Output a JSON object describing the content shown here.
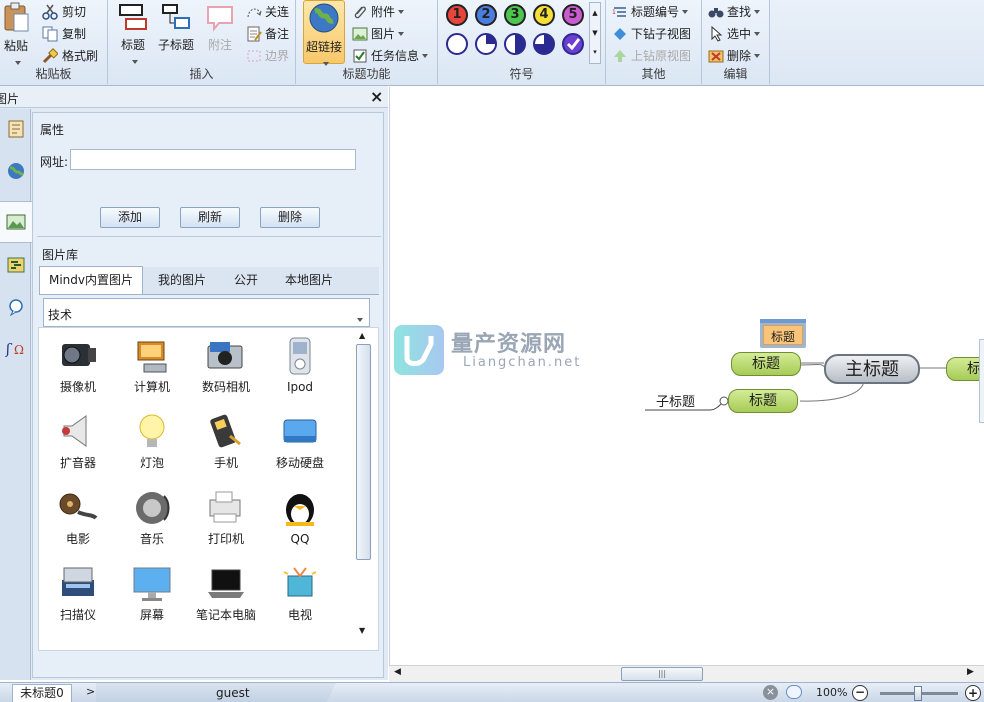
{
  "ribbon": {
    "clipboard": {
      "paste": "粘贴",
      "cut": "剪切",
      "copy": "复制",
      "format_painter": "格式刷",
      "group": "粘贴板"
    },
    "insert": {
      "topic": "标题",
      "subtopic": "子标题",
      "callout": "附注",
      "relation": "关连",
      "note": "备注",
      "boundary": "边界",
      "group": "插入"
    },
    "topic_func": {
      "hyperlink": "超链接",
      "attachment": "附件",
      "image": "图片",
      "task": "任务信息",
      "group": "标题功能"
    },
    "symbols": {
      "items": [
        "1",
        "2",
        "3",
        "4",
        "5"
      ],
      "group": "符号"
    },
    "other": {
      "numbering": "标题编号",
      "drill_down": "下钻子视图",
      "drill_up": "上钻原视图",
      "group": "其他"
    },
    "edit": {
      "find": "查找",
      "select": "选中",
      "delete": "删除",
      "group": "编辑"
    }
  },
  "panel": {
    "title": "图片",
    "props_header": "属性",
    "url_label": "网址:",
    "url_value": "",
    "add": "添加",
    "refresh": "刷新",
    "delete": "删除",
    "library": "图片库",
    "tabs": [
      "Mindv内置图片",
      "我的图片",
      "公开",
      "本地图片"
    ],
    "category": "技术",
    "images": [
      "摄像机",
      "计算机",
      "数码相机",
      "Ipod",
      "扩音器",
      "灯泡",
      "手机",
      "移动硬盘",
      "电影",
      "音乐",
      "打印机",
      "QQ",
      "扫描仪",
      "屏幕",
      "笔记本电脑",
      "电视"
    ]
  },
  "canvas": {
    "watermark_cn": "量产资源网",
    "watermark_en": "Liangchan.net",
    "central": "主标题",
    "topic1": "标题",
    "topic2": "标题",
    "topic3": "标",
    "sub": "子标题",
    "floating": "标题"
  },
  "status": {
    "tab": "未标题0",
    "arrow": ">",
    "user": "guest",
    "zoom": "100%"
  },
  "colors": {
    "ribbon_bg": "#dbe6f4",
    "topic_green": "#b5d86a",
    "central_gray": "#c7ccd2",
    "accent_orange": "#f7c86b"
  }
}
